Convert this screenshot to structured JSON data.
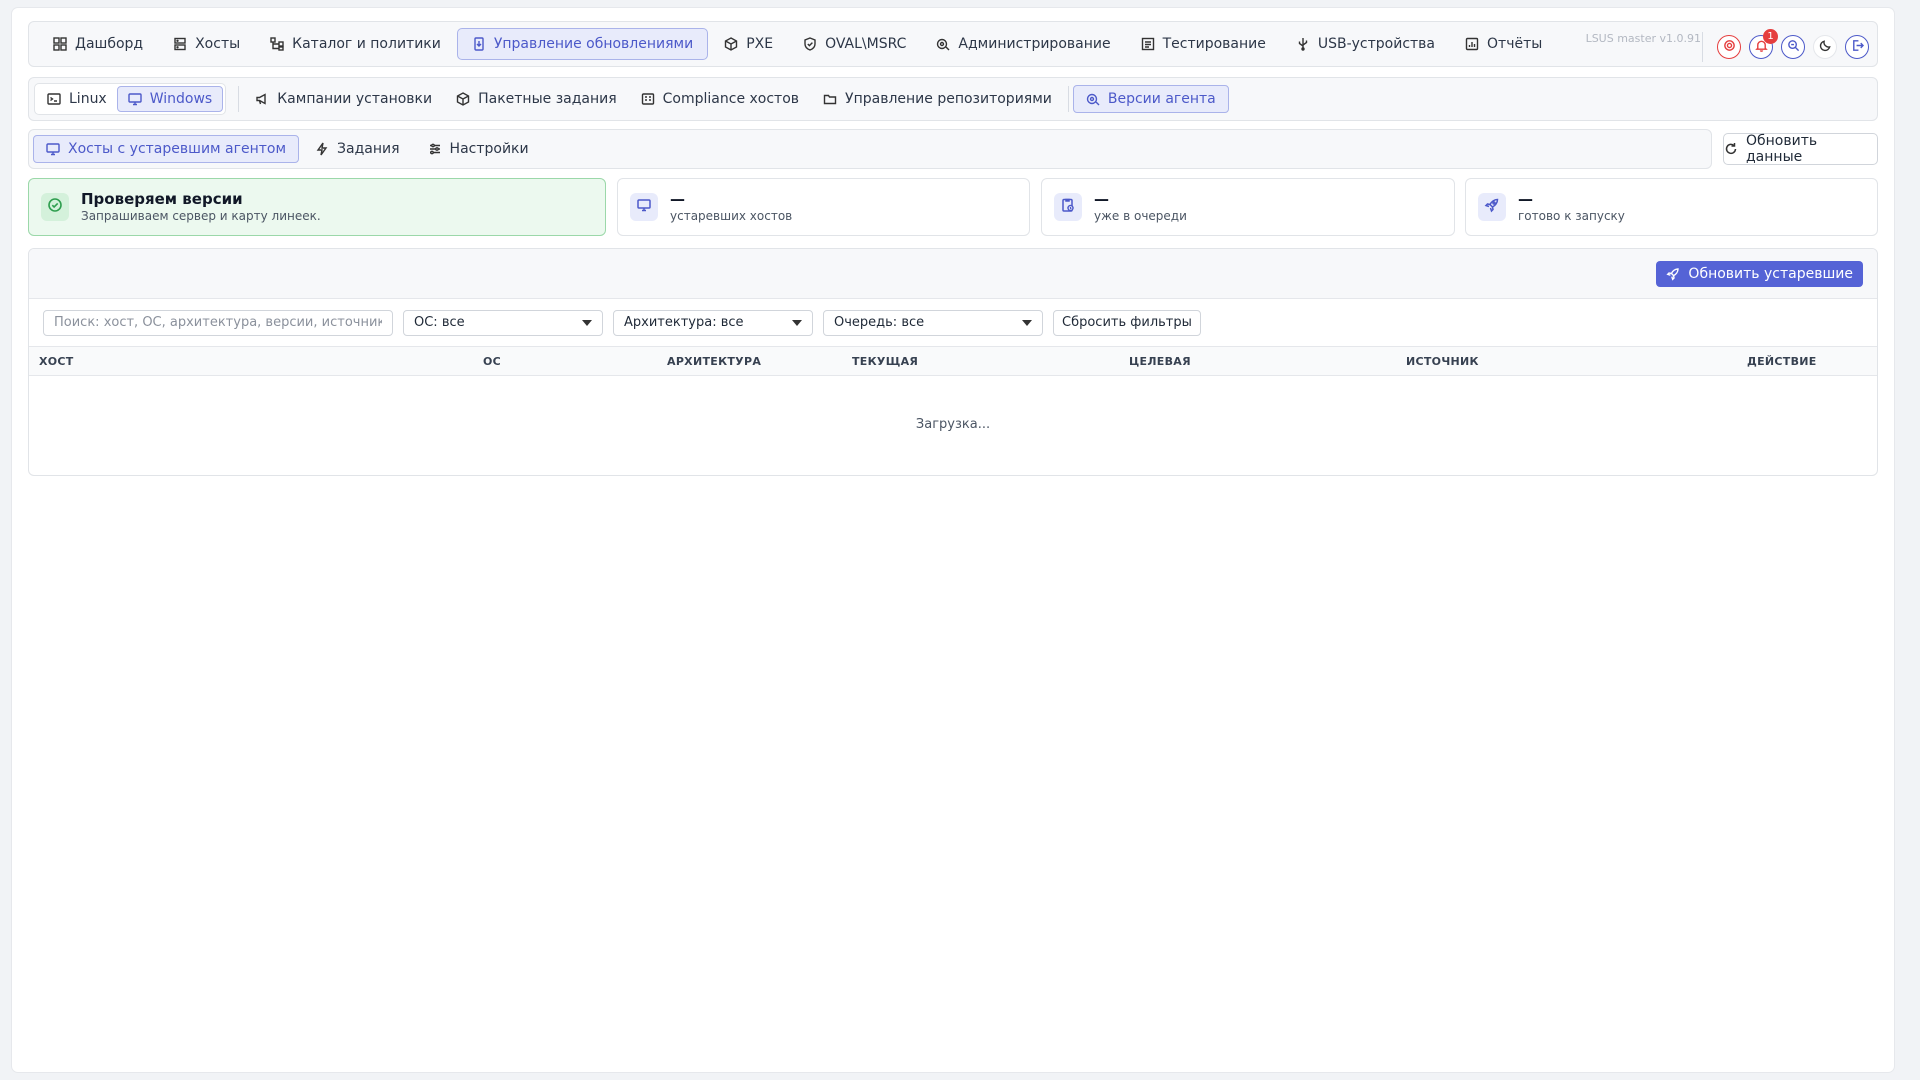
{
  "app": {
    "version": "LSUS master v1.0.91",
    "notifications_count": "1"
  },
  "topnav": {
    "items": [
      {
        "label": "Дашборд",
        "icon": "dashboard-icon"
      },
      {
        "label": "Хосты",
        "icon": "server-icon"
      },
      {
        "label": "Каталог и политики",
        "icon": "hierarchy-icon"
      },
      {
        "label": "Управление обновлениями",
        "icon": "update-doc-icon",
        "active": true
      },
      {
        "label": "PXE",
        "icon": "box-icon"
      },
      {
        "label": "OVAL\\MSRC",
        "icon": "shield-icon"
      },
      {
        "label": "Администрирование",
        "icon": "admin-gear-icon"
      },
      {
        "label": "Тестирование",
        "icon": "checklist-icon"
      },
      {
        "label": "USB-устройства",
        "icon": "usb-icon"
      },
      {
        "label": "Отчёты",
        "icon": "report-icon"
      }
    ]
  },
  "subnav": {
    "os": [
      {
        "label": "Linux",
        "icon": "terminal-icon"
      },
      {
        "label": "Windows",
        "icon": "monitor-icon",
        "active": true
      }
    ],
    "items": [
      {
        "label": "Кампании установки",
        "icon": "megaphone-icon"
      },
      {
        "label": "Пакетные задания",
        "icon": "package-icon"
      },
      {
        "label": "Compliance хостов",
        "icon": "compliance-icon"
      },
      {
        "label": "Управление репозиториями",
        "icon": "folder-icon"
      }
    ],
    "agent_versions": {
      "label": "Версии агента",
      "icon": "agent-gear-icon",
      "active": true
    }
  },
  "tabs": [
    {
      "label": "Хосты с устаревшим агентом",
      "icon": "monitor-icon",
      "active": true
    },
    {
      "label": "Задания",
      "icon": "lightning-icon"
    },
    {
      "label": "Настройки",
      "icon": "sliders-icon"
    }
  ],
  "refresh_label": "Обновить данные",
  "cards": {
    "status": {
      "title": "Проверяем версии",
      "subtitle": "Запрашиваем сервер и карту линеек."
    },
    "outdated": {
      "value": "—",
      "label": "устаревших хостов"
    },
    "queued": {
      "value": "—",
      "label": "уже в очереди"
    },
    "ready": {
      "value": "—",
      "label": "готово к запуску"
    }
  },
  "update_outdated_label": "Обновить устаревшие",
  "filters": {
    "search_placeholder": "Поиск: хост, ОС, архитектура, версии, источник...",
    "os": "ОС: все",
    "arch": "Архитектура: все",
    "queue": "Очередь: все",
    "reset": "Сбросить фильтры"
  },
  "table": {
    "columns": [
      "ХОСТ",
      "ОС",
      "АРХИТЕКТУРА",
      "ТЕКУЩАЯ",
      "ЦЕЛЕВАЯ",
      "ИСТОЧНИК",
      "ДЕЙСТВИЕ"
    ],
    "loading": "Загрузка..."
  },
  "colors": {
    "accent": "#4c59c9",
    "accent_bg": "#e8ebfb",
    "success_bg": "#ecf9ef",
    "primary_button": "#5563d6",
    "danger": "#e53e3e"
  }
}
